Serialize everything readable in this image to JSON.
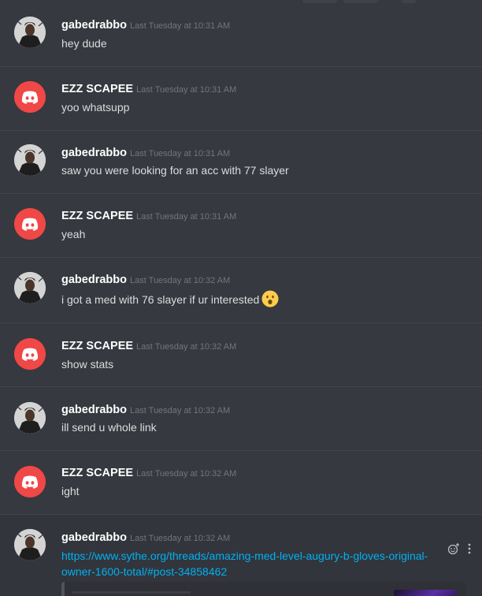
{
  "messages": [
    {
      "author": "gabedrabbo",
      "avatar": "user-photo-avatar",
      "time": "Last Tuesday at 10:31 AM",
      "text": "hey dude"
    },
    {
      "author": "EZZ SCAPEE",
      "avatar": "discord-logo-avatar",
      "time": "Last Tuesday at 10:31 AM",
      "text": "yoo whatsupp"
    },
    {
      "author": "gabedrabbo",
      "avatar": "user-photo-avatar",
      "time": "Last Tuesday at 10:31 AM",
      "text": "saw you were looking for an acc with 77 slayer"
    },
    {
      "author": "EZZ SCAPEE",
      "avatar": "discord-logo-avatar",
      "time": "Last Tuesday at 10:31 AM",
      "text": "yeah"
    },
    {
      "author": "gabedrabbo",
      "avatar": "user-photo-avatar",
      "time": "Last Tuesday at 10:32 AM",
      "text": "i got a med with 76 slayer if ur interested",
      "emoji": "hushed-face-emoji"
    },
    {
      "author": "EZZ SCAPEE",
      "avatar": "discord-logo-avatar",
      "time": "Last Tuesday at 10:32 AM",
      "text": "show stats"
    },
    {
      "author": "gabedrabbo",
      "avatar": "user-photo-avatar",
      "time": "Last Tuesday at 10:32 AM",
      "text": "ill send u whole link"
    },
    {
      "author": "EZZ SCAPEE",
      "avatar": "discord-logo-avatar",
      "time": "Last Tuesday at 10:32 AM",
      "text": "ight"
    },
    {
      "author": "gabedrabbo",
      "avatar": "user-photo-avatar",
      "time": "Last Tuesday at 10:32 AM",
      "link": "https://www.sythe.org/threads/amazing-med-level-augury-b-gloves-original-owner-1600-total/#post-34858462"
    }
  ],
  "tools": {
    "react_icon": "add-reaction-icon",
    "more_icon": "more-options-icon"
  },
  "colors": {
    "background": "#36393f",
    "link": "#00b0f4",
    "discord_red": "#f04747",
    "username": "#ffffff",
    "timestamp": "#72767d",
    "text": "#dcddde"
  }
}
